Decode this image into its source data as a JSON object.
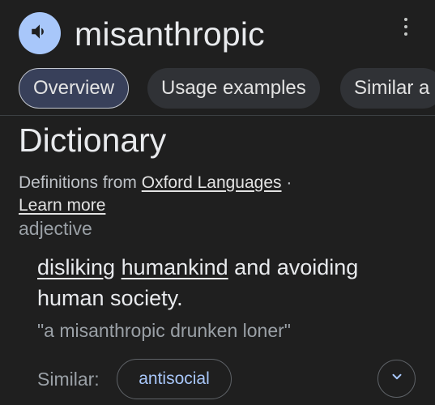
{
  "header": {
    "speaker_icon": "speaker-icon",
    "word": "misanthropic",
    "menu_icon": "more-vert-icon"
  },
  "tabs": [
    {
      "label": "Overview",
      "active": true
    },
    {
      "label": "Usage examples",
      "active": false
    },
    {
      "label": "Similar a",
      "active": false
    }
  ],
  "section": {
    "title": "Dictionary",
    "source_prefix": "Definitions from",
    "source_link": "Oxford Languages",
    "source_suffix": "·",
    "learn_more": "Learn more"
  },
  "entry": {
    "part_of_speech": "adjective",
    "definition": {
      "word1": "disliking",
      "word2": "humankind",
      "rest_line": "and avoiding human society."
    },
    "example": "\"a misanthropic drunken loner\"",
    "similar_label": "Similar:",
    "similar": [
      "antisocial"
    ],
    "expand_icon": "chevron-down-icon"
  },
  "colors": {
    "background": "#1f1f1f",
    "accent": "#a8c7fa",
    "tab_active_bg": "#38405a",
    "tab_bg": "#303236",
    "muted_text": "#9aa0a6"
  }
}
